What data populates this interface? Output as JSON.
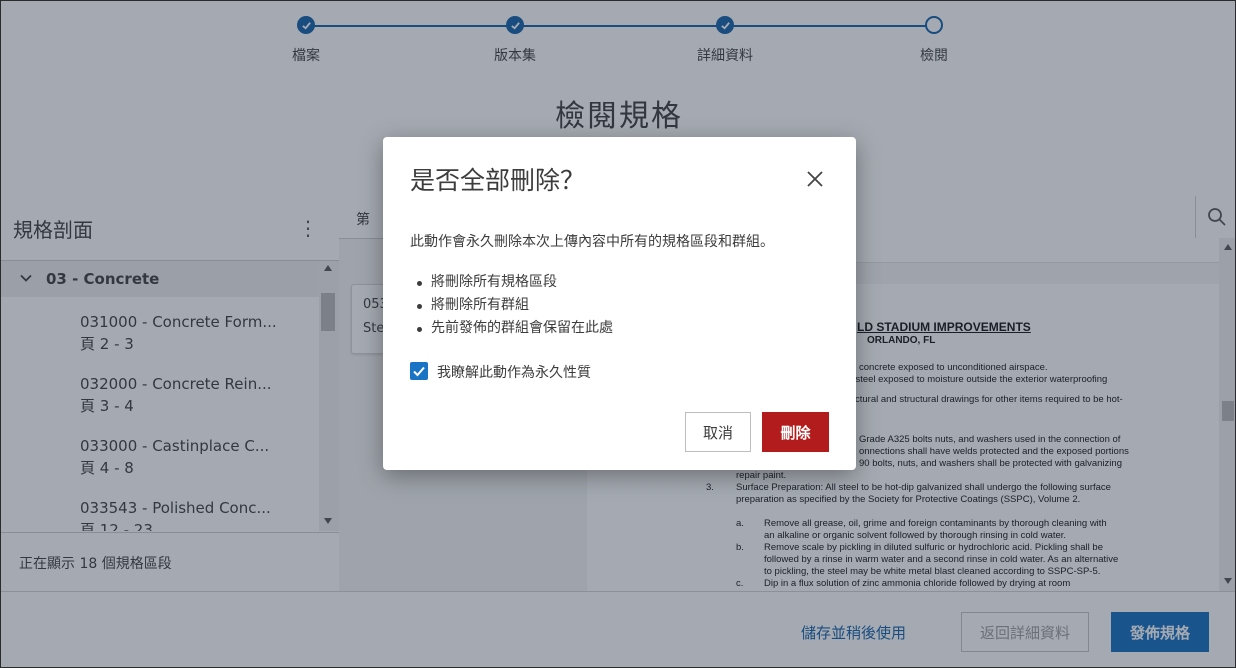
{
  "stepper": {
    "steps": [
      {
        "label": "檔案",
        "state": "complete"
      },
      {
        "label": "版本集",
        "state": "complete"
      },
      {
        "label": "詳細資料",
        "state": "complete"
      },
      {
        "label": "檢閱",
        "state": "current"
      }
    ]
  },
  "page_title": "檢閱規格",
  "left_panel": {
    "title": "規格剖面",
    "group_label": "03 - Concrete",
    "items": [
      {
        "name": "031000 - Concrete Form...",
        "pages": "頁 2 - 3"
      },
      {
        "name": "032000 - Concrete Rein...",
        "pages": "頁 3 - 4"
      },
      {
        "name": "033000 - Castinplace C...",
        "pages": "頁 4 - 8"
      },
      {
        "name": "033543 - Polished Conc...",
        "pages": "頁 12 - 23"
      }
    ],
    "footer": "正在顯示 18 個規格區段"
  },
  "middle_panel": {
    "tab_label": "第",
    "card_line1": "053",
    "card_line2": "Ste"
  },
  "document": {
    "title": "LD STADIUM IMPROVEMENTS",
    "subtitle": "ORLANDO, FL",
    "lines": [
      "concrete exposed to unconditioned airspace.",
      "rt steel exposed to moisture outside the exterior waterproofing",
      "ctural and structural drawings for other items required to be hot-",
      "Grade A325 bolts nuts, and washers used in the connection of",
      "onnections shall have welds protected and the exposed portions",
      "90 bolts, nuts, and washers shall be protected with galvanizing",
      "repair paint.",
      "Surface Preparation:  All steel to be hot-dip galvanized shall undergo the following surface",
      "preparation as specified by the Society for Protective Coatings (SSPC), Volume 2.",
      "Remove all grease, oil, grime and foreign contaminants by thorough cleaning with",
      "an alkaline or organic solvent followed by thorough rinsing in cold water.",
      "Remove scale by pickling in diluted sulfuric or hydrochloric acid.  Pickling shall be",
      "followed by a rinse in warm water and a second rinse in cold water.  As an alternative",
      "to pickling, the steel may be white metal blast cleaned according to SSPC-SP-5.",
      "Dip in a flux solution of zinc ammonia chloride followed by drying at room"
    ],
    "markers": {
      "n3": "3.",
      "a": "a.",
      "b": "b.",
      "c": "c."
    }
  },
  "bottom_bar": {
    "save_later": "儲存並稍後使用",
    "back_details": "返回詳細資料",
    "publish": "發佈規格"
  },
  "modal": {
    "title": "是否全部刪除？",
    "description": "此動作會永久刪除本次上傳內容中所有的規格區段和群組。",
    "bullets": [
      "將刪除所有規格區段",
      "將刪除所有群組",
      "先前發佈的群組會保留在此處"
    ],
    "checkbox_label": "我瞭解此動作為永久性質",
    "checkbox_checked": true,
    "cancel_label": "取消",
    "delete_label": "刪除"
  },
  "colors": {
    "primary": "#0e6bbf",
    "step": "#0e5ea8",
    "danger": "#b31c1c",
    "text": "#3c3c3c"
  }
}
